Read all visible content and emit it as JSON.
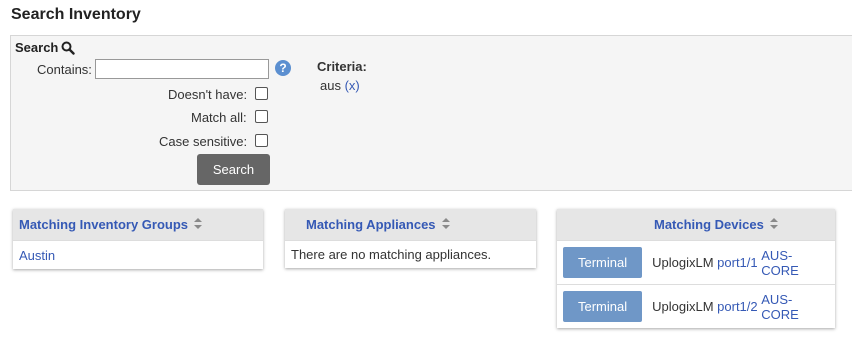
{
  "page": {
    "title": "Search Inventory"
  },
  "search": {
    "heading": "Search",
    "contains_label": "Contains:",
    "contains_value": "",
    "help_symbol": "?",
    "doesnt_have_label": "Doesn't have:",
    "match_all_label": "Match all:",
    "case_sensitive_label": "Case sensitive:",
    "button_label": "Search",
    "criteria_title": "Criteria:",
    "criteria": [
      {
        "term": "aus",
        "remove_label": "(x)"
      }
    ]
  },
  "groups_card": {
    "header": "Matching Inventory Groups",
    "items": [
      "Austin"
    ]
  },
  "appliances_card": {
    "header": "Matching Appliances",
    "empty_message": "There are no matching appliances."
  },
  "devices_card": {
    "header": "Matching Devices",
    "rows": [
      {
        "button": "Terminal",
        "appliance": "UplogixLM",
        "port": "port1/1",
        "device": "AUS-CORE"
      },
      {
        "button": "Terminal",
        "appliance": "UplogixLM",
        "port": "port1/2",
        "device": "AUS-CORE"
      }
    ]
  },
  "colors": {
    "link": "#3559b5",
    "terminal_button": "#6f97c7",
    "search_button": "#666666",
    "help_icon": "#5b8fd0"
  }
}
